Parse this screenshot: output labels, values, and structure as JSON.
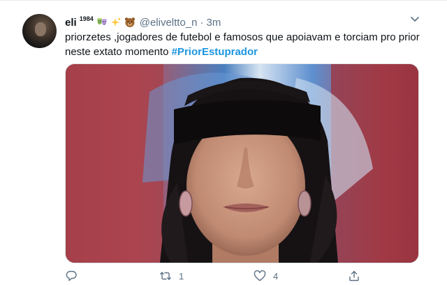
{
  "tweet": {
    "display_name": "eli",
    "display_name_superscript": "1984",
    "handle": "@eliveltto_n",
    "separator": "·",
    "time": "3m",
    "text": "priorzetes ,jogadores de futebol e famosos que apoiavam e torciam pro prior neste extato momento ",
    "hashtag": "#PriorEstuprador",
    "emojis": [
      "masks-emoji",
      "sparkles-emoji",
      "bear-emoji"
    ],
    "retweet_count": "1",
    "like_count": "4",
    "colors": {
      "text": "#0f1419",
      "secondary": "#5b7083",
      "link": "#1b95e0",
      "border": "#e6ecf0"
    }
  }
}
